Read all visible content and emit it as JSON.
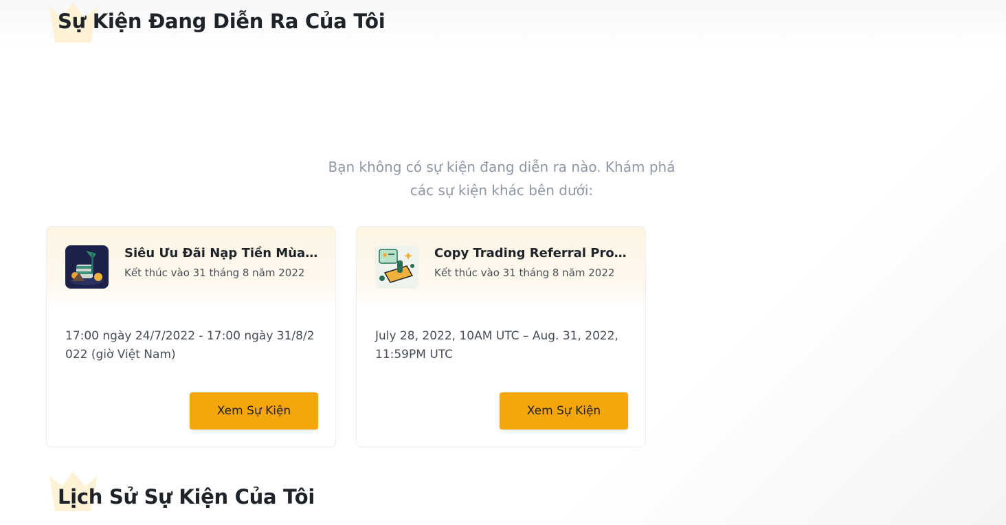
{
  "ongoing": {
    "title": "Sự Kiện Đang Diễn Ra Của Tôi",
    "empty_line_1": "Bạn không có sự kiện đang diễn ra nào. Khám phá",
    "empty_line_2": "các sự kiện khác bên dưới:"
  },
  "events": [
    {
      "title": "Siêu Ưu Đãi Nạp Tiền Mùa Hè Binance Việt Nam",
      "end": "Kết thúc vào 31 tháng 8 năm 2022",
      "period": "17:00 ngày 24/7/2022 - 17:00 ngày 31/8/2022 (giờ Việt Nam)",
      "button": "Xem Sự Kiện",
      "icon": "summer-deposit-promo-thumbnail"
    },
    {
      "title": "Copy Trading Referral Program",
      "end": "Kết thúc vào 31 tháng 8 năm 2022",
      "period": "July 28, 2022, 10AM UTC – Aug. 31, 2022, 11:59PM UTC",
      "button": "Xem Sự Kiện",
      "icon": "copy-trading-referral-thumbnail"
    }
  ],
  "history": {
    "title": "Lịch Sử Sự Kiện Của Tôi"
  },
  "colors": {
    "accent": "#f5a60a",
    "crown": "#fdf1d6",
    "muted_text": "#8f96a3",
    "card_header": "#fdf4e3"
  }
}
